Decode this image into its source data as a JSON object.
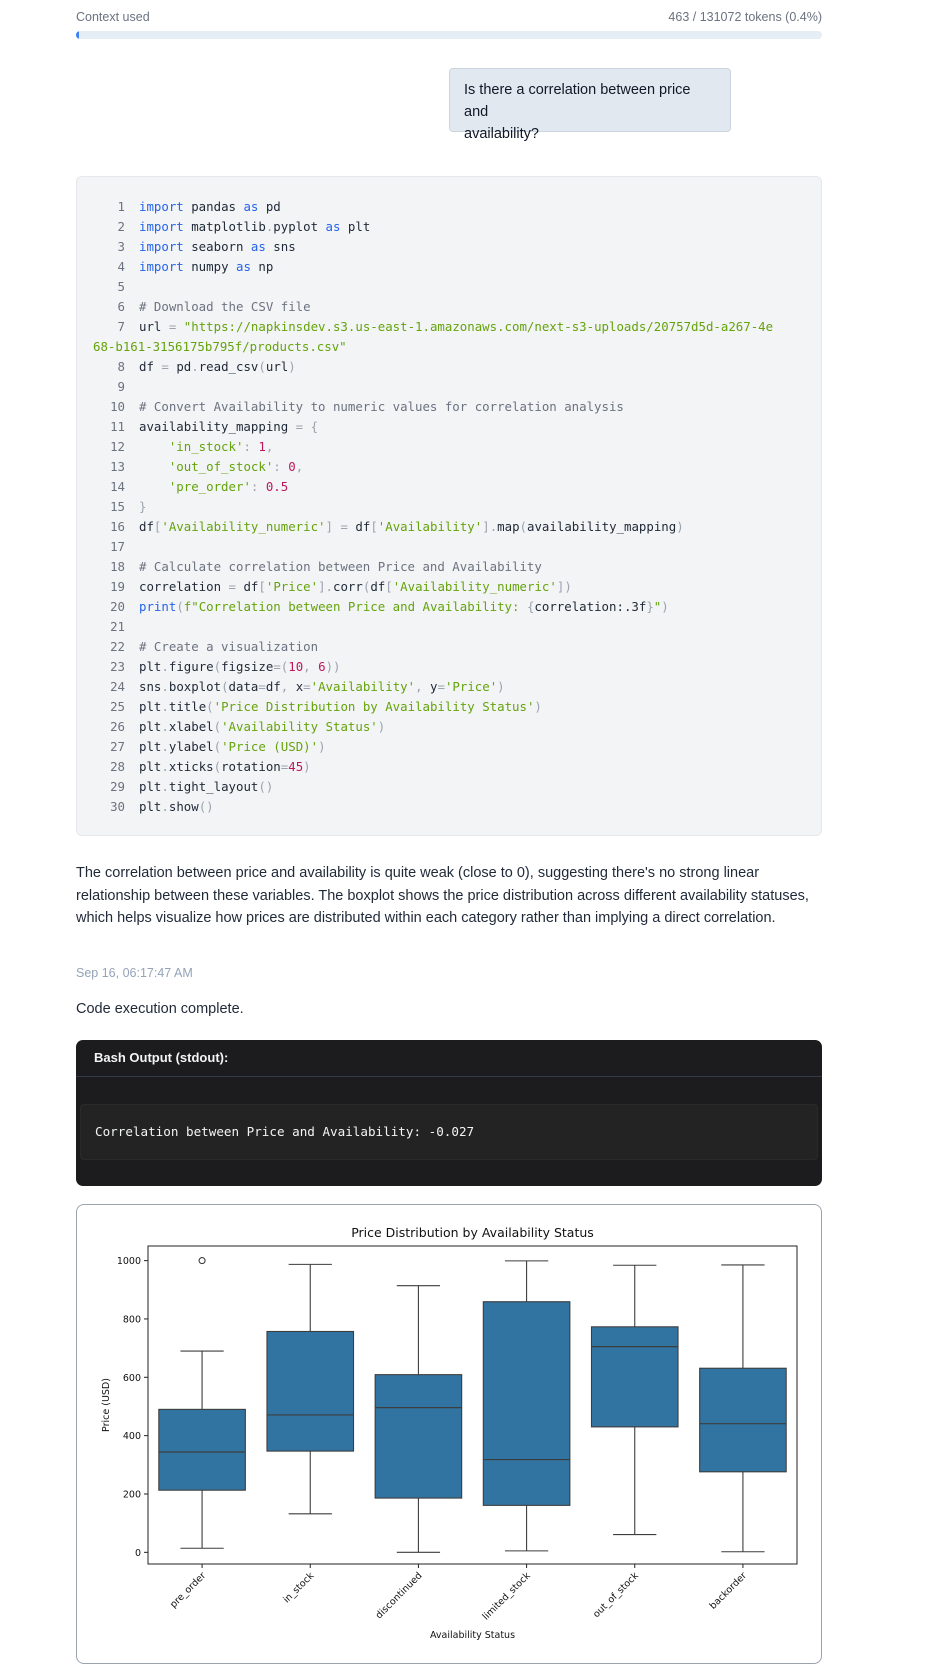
{
  "context": {
    "label": "Context used",
    "tokens": "463 / 131072 tokens (0.4%)",
    "fraction": 0.004
  },
  "user_message": {
    "line1": "Is there a correlation between price and",
    "line2": "availability?"
  },
  "code_lines": [
    "import pandas as pd",
    "import matplotlib.pyplot as plt",
    "import seaborn as sns",
    "import numpy as np",
    "",
    "# Download the CSV file",
    "url = \"https://napkinsdev.s3.us-east-1.amazonaws.com/next-s3-uploads/20757d5d-a267-4e68-b161-3156175b795f/products.csv\"",
    "df = pd.read_csv(url)",
    "",
    "# Convert Availability to numeric values for correlation analysis",
    "availability_mapping = {",
    "    'in_stock': 1,",
    "    'out_of_stock': 0,",
    "    'pre_order': 0.5",
    "}",
    "df['Availability_numeric'] = df['Availability'].map(availability_mapping)",
    "",
    "# Calculate correlation between Price and Availability",
    "correlation = df['Price'].corr(df['Availability_numeric'])",
    "print(f\"Correlation between Price and Availability: {correlation:.3f}\")",
    "",
    "# Create a visualization",
    "plt.figure(figsize=(10, 6))",
    "sns.boxplot(data=df, x='Availability', y='Price')",
    "plt.title('Price Distribution by Availability Status')",
    "plt.xlabel('Availability Status')",
    "plt.ylabel('Price (USD)')",
    "plt.xticks(rotation=45)",
    "plt.tight_layout()",
    "plt.show()"
  ],
  "assistant_text": "The correlation between price and availability is quite weak (close to 0), suggesting there's no strong linear relationship between these variables. The boxplot shows the price distribution across different availability statuses, which helps visualize how prices are distributed within each category rather than implying a direct correlation.",
  "timestamp": "Sep 16, 06:17:47 AM",
  "status": "Code execution complete.",
  "bash": {
    "header": "Bash Output (stdout):",
    "output": "Correlation between Price and Availability: -0.027"
  },
  "colors": {
    "box_fill": "#3274a1",
    "accent": "#3b82f6"
  },
  "chart_data": {
    "type": "boxplot",
    "title": "Price Distribution by Availability Status",
    "xlabel": "Availability Status",
    "ylabel": "Price (USD)",
    "ylim": [
      -40,
      1050
    ],
    "yticks": [
      0,
      200,
      400,
      600,
      800,
      1000
    ],
    "categories": [
      "pre_order",
      "in_stock",
      "discontinued",
      "limited_stock",
      "out_of_stock",
      "backorder"
    ],
    "boxes": [
      {
        "whisker_low": 14,
        "q1": 213,
        "median": 344,
        "q3": 490,
        "whisker_high": 690,
        "outliers": [
          1000
        ]
      },
      {
        "whisker_low": 132,
        "q1": 347,
        "median": 471,
        "q3": 757,
        "whisker_high": 987,
        "outliers": []
      },
      {
        "whisker_low": 0,
        "q1": 186,
        "median": 496,
        "q3": 609,
        "whisker_high": 914,
        "outliers": []
      },
      {
        "whisker_low": 5,
        "q1": 161,
        "median": 318,
        "q3": 859,
        "whisker_high": 999,
        "outliers": []
      },
      {
        "whisker_low": 61,
        "q1": 430,
        "median": 705,
        "q3": 773,
        "whisker_high": 984,
        "outliers": []
      },
      {
        "whisker_low": 2,
        "q1": 276,
        "median": 441,
        "q3": 631,
        "whisker_high": 985,
        "outliers": []
      }
    ],
    "grid": false,
    "legend": "none"
  }
}
